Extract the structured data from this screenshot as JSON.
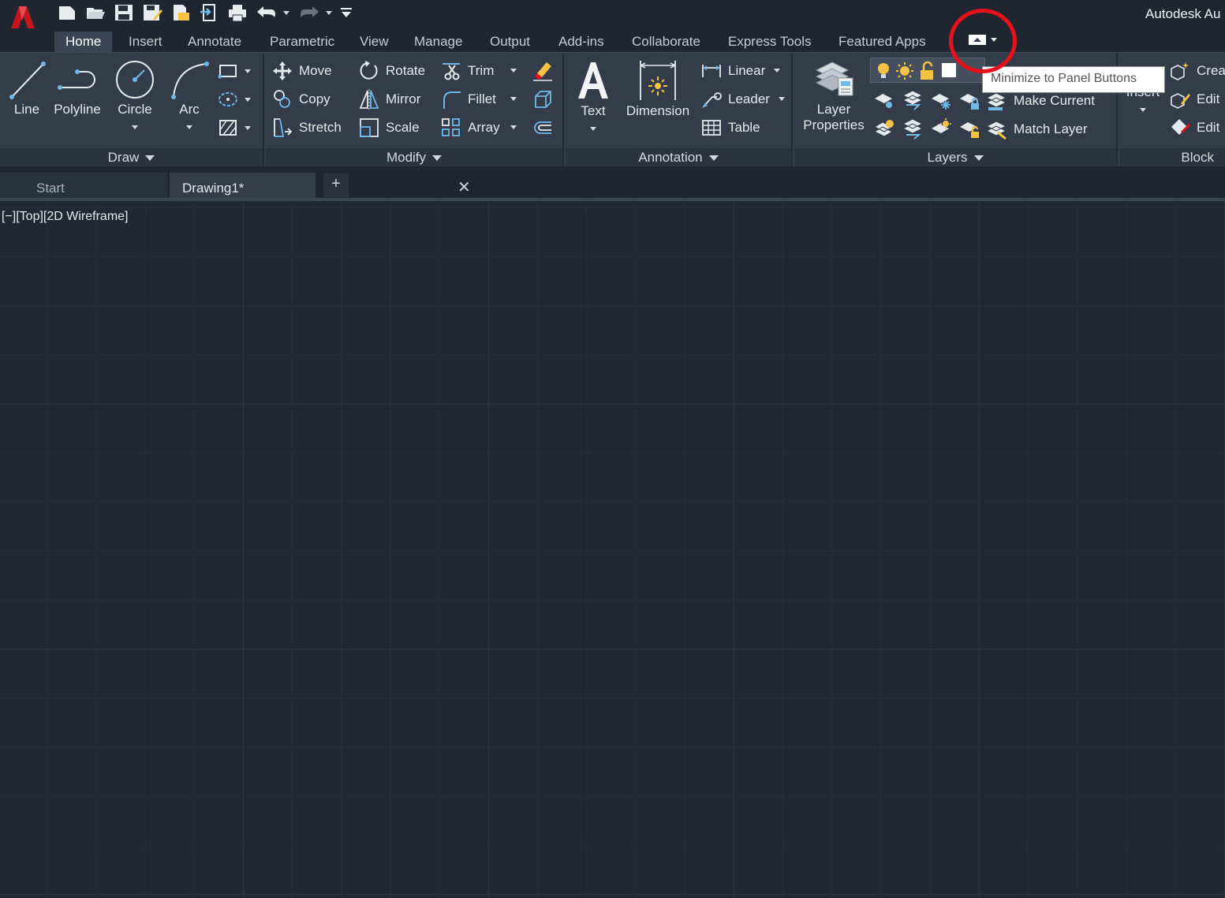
{
  "window": {
    "title": "Autodesk Au"
  },
  "quick_access": [
    "new-icon",
    "open-icon",
    "save-icon",
    "save-as-icon",
    "plot-preview-icon",
    "share-icon",
    "print-icon",
    "undo-icon",
    "redo-icon",
    "customize-icon"
  ],
  "ribbon_tabs": [
    {
      "label": "Home",
      "active": true
    },
    {
      "label": "Insert"
    },
    {
      "label": "Annotate"
    },
    {
      "label": "Parametric"
    },
    {
      "label": "View"
    },
    {
      "label": "Manage"
    },
    {
      "label": "Output"
    },
    {
      "label": "Add-ins"
    },
    {
      "label": "Collaborate"
    },
    {
      "label": "Express Tools"
    },
    {
      "label": "Featured Apps"
    }
  ],
  "tooltip": "Minimize to Panel Buttons",
  "panels": {
    "draw": {
      "title": "Draw",
      "line": "Line",
      "polyline": "Polyline",
      "circle": "Circle",
      "arc": "Arc"
    },
    "modify": {
      "title": "Modify",
      "move": "Move",
      "rotate": "Rotate",
      "trim": "Trim",
      "copy": "Copy",
      "mirror": "Mirror",
      "fillet": "Fillet",
      "stretch": "Stretch",
      "scale": "Scale",
      "array": "Array"
    },
    "annotation": {
      "title": "Annotation",
      "text": "Text",
      "dimension": "Dimension",
      "linear": "Linear",
      "leader": "Leader",
      "table": "Table"
    },
    "layers": {
      "title": "Layers",
      "layer_properties_1": "Layer",
      "layer_properties_2": "Properties",
      "make_current": "Make Current",
      "match_layer": "Match Layer"
    },
    "block": {
      "title": "Block",
      "insert": "Insert",
      "create": "Crea",
      "edit": "Edit",
      "edit_attr": "Edit"
    }
  },
  "file_tabs": {
    "start": "Start",
    "drawing": "Drawing1*",
    "close": "✕",
    "add": "+"
  },
  "viewport": {
    "label": "[−][Top][2D Wireframe]"
  },
  "colors": {
    "accent_red": "#e8101a",
    "icon_blue": "#6fb8e8",
    "icon_yellow": "#f5c242"
  }
}
